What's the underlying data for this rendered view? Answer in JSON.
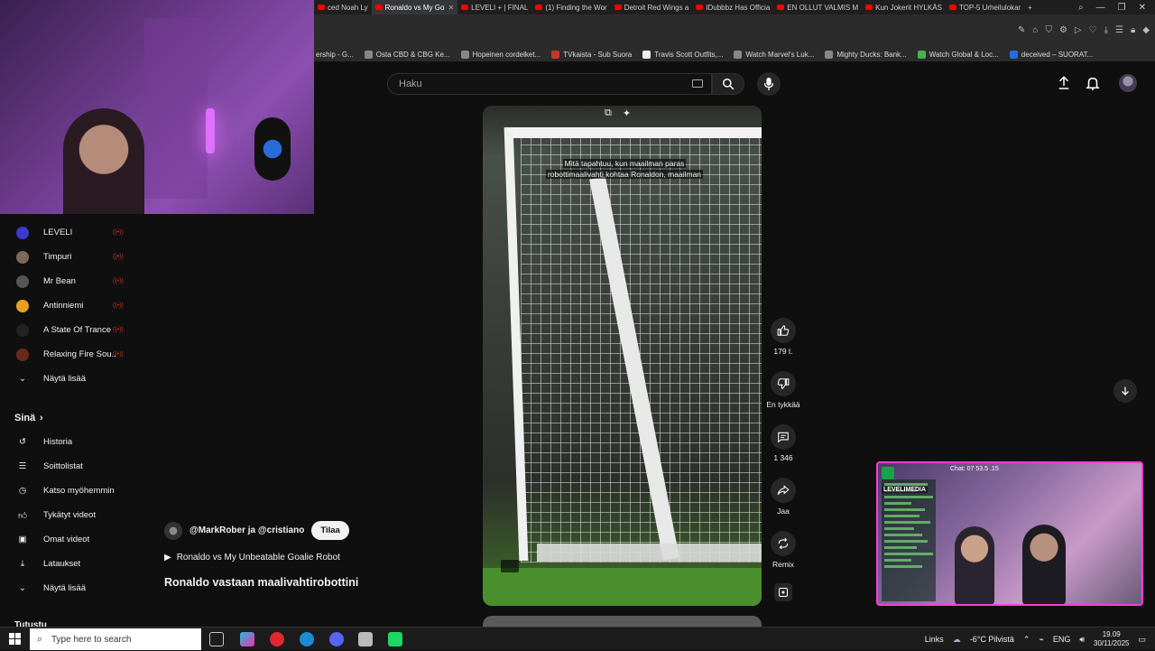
{
  "browser": {
    "tabs": [
      {
        "label": "ced Noah Ly",
        "active": false
      },
      {
        "label": "Ronaldo vs My Go",
        "active": true
      },
      {
        "label": "LEVELI + | FINAL",
        "active": false
      },
      {
        "label": "(1) Finding the Wor",
        "active": false
      },
      {
        "label": "Detroit Red Wings a",
        "active": false
      },
      {
        "label": "IDubbbz Has Officia",
        "active": false
      },
      {
        "label": "EN OLLUT VALMIS M",
        "active": false
      },
      {
        "label": "Kun Jokerit HYLKÄS",
        "active": false
      },
      {
        "label": "TOP-5 Urheilulokar",
        "active": false
      }
    ],
    "bookmarks": [
      {
        "label": "ership - G..."
      },
      {
        "label": "Osta CBD & CBG Ke..."
      },
      {
        "label": "Hopeinen cordelket..."
      },
      {
        "label": "TVkaista - Sub Suora"
      },
      {
        "label": "Travis Scott Outfits,..."
      },
      {
        "label": "Watch Marvel's Luk..."
      },
      {
        "label": "Mighty Ducks: Bank..."
      },
      {
        "label": "Watch Global & Loc..."
      },
      {
        "label": "deceived – SUORAT..."
      }
    ]
  },
  "youtube": {
    "search_placeholder": "Haku",
    "sidebar": {
      "subscriptions": [
        {
          "label": "LEVELI",
          "color": "#3b3bd1"
        },
        {
          "label": "Timpuri",
          "color": "#7a6a5a"
        },
        {
          "label": "Mr Bean",
          "color": "#555555"
        },
        {
          "label": "Antinniemi",
          "color": "#e8a020"
        },
        {
          "label": "A State Of Trance",
          "color": "#222222"
        },
        {
          "label": "Relaxing Fire Sou...",
          "color": "#6a2a1a"
        }
      ],
      "show_more_1": "Näytä lisää",
      "you_heading": "Sinä",
      "you_items": [
        {
          "label": "Historia",
          "icon": "history-icon"
        },
        {
          "label": "Soittolistat",
          "icon": "playlists-icon"
        },
        {
          "label": "Katso myöhemmin",
          "icon": "watch-later-icon"
        },
        {
          "label": "Tykätyt videot",
          "icon": "liked-icon"
        },
        {
          "label": "Omat videot",
          "icon": "my-videos-icon"
        },
        {
          "label": "Lataukset",
          "icon": "downloads-icon"
        }
      ],
      "show_more_2": "Näytä lisää",
      "next_heading": "Tutustu"
    },
    "short": {
      "caption_line1": "Mitä tapahtuu, kun maailman paras",
      "caption_line2": "robottimaalivahti kohtaa Ronaldon, maailman",
      "likes": "179 t.",
      "dislike_label": "En tykkää",
      "comments": "1 346",
      "share_label": "Jaa",
      "remix_label": "Remix",
      "channel": "@MarkRober ja @cristiano",
      "subscribe_label": "Tilaa",
      "related_video": "Ronaldo vs My Unbeatable Goalie Robot",
      "title": "Ronaldo vastaan maalivahtirobottini"
    }
  },
  "stream_overlay": {
    "channel": "LEVELIMEDIA",
    "top_text": "Chat: 07 53.5 .15"
  },
  "taskbar": {
    "search_placeholder": "Type here to search",
    "links_label": "Links",
    "weather": "-6°C Pilvistä",
    "language": "ENG",
    "time": "19.09",
    "date": "30/11/2025"
  }
}
